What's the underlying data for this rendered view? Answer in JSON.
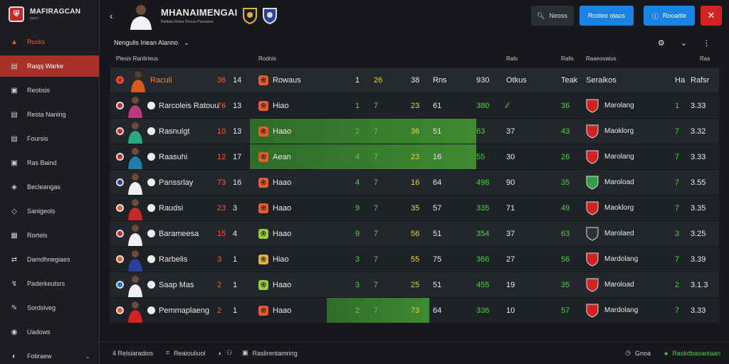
{
  "brand": {
    "title": "MAFIRAGCAN",
    "sub": "aucci"
  },
  "sidebar": {
    "items": [
      {
        "label": "Rocks",
        "icon": "flame-icon",
        "glyph": "▲"
      },
      {
        "label": "Raspj Warke",
        "icon": "table-icon",
        "glyph": "▤",
        "active": true
      },
      {
        "label": "Reotisis",
        "icon": "calendar-icon",
        "glyph": "▣"
      },
      {
        "label": "Resta Naning",
        "icon": "clipboard-icon",
        "glyph": "▤"
      },
      {
        "label": "Foursis",
        "icon": "list-icon",
        "glyph": "▤"
      },
      {
        "label": "Ras Baind",
        "icon": "trophy-icon",
        "glyph": "▣"
      },
      {
        "label": "Becleangas",
        "icon": "users-icon",
        "glyph": "◈"
      },
      {
        "label": "Sanigeols",
        "icon": "pin-icon",
        "glyph": "◇"
      },
      {
        "label": "Rortels",
        "icon": "stats-icon",
        "glyph": "▦"
      },
      {
        "label": "Damdhnegiaes",
        "icon": "transfer-icon",
        "glyph": "⇄"
      },
      {
        "label": "Paderkeutsrs",
        "icon": "share-icon",
        "glyph": "↯"
      },
      {
        "label": "Sordsiveg",
        "icon": "edit-icon",
        "glyph": "✎"
      },
      {
        "label": "Uadows",
        "icon": "settings-icon",
        "glyph": "◉"
      },
      {
        "label": "Fotiraew",
        "icon": "user-icon",
        "glyph": "◐",
        "chevron": "⌄"
      }
    ]
  },
  "topbar": {
    "title": "MHANAIMENGAI",
    "sub": "Ratikaw Rotos Orocos Poonaeus",
    "search_label": "Neoss",
    "blue1_label": "Rcoleo olaos",
    "blue2_label": "Rooaitie",
    "close_label": "✕"
  },
  "filters": {
    "select_label": "Nengulis  Iriean Alanno",
    "chevron": "⌄",
    "tool1": "⚙",
    "tool2": "⌄",
    "tool3": "⋮"
  },
  "table": {
    "headers": {
      "player": "Plesis Ranlirieus",
      "club": "Rodnis",
      "c1": "Rals",
      "c2": "Ralis",
      "c3": "Raaeovatus",
      "c4": "Ras"
    },
    "first_row": {
      "badge": "Raculi",
      "a": "36",
      "b": "14",
      "club": "Rowaus",
      "c1": "1",
      "c2": "26",
      "c3": "38",
      "c4": "Rns",
      "c5": "930",
      "c6": "Otkus",
      "c7": "Teak",
      "c8": "Seraikos",
      "c9": "Ha",
      "c10": "Rafsr"
    },
    "rows": [
      {
        "name": "Rarcoleis Ratouu",
        "a": "76",
        "b": "13",
        "club": "Hiao",
        "g": "1",
        "h": "7",
        "i": "23",
        "j": "61",
        "k": "380",
        "l": "⁄⁄",
        "m": "36",
        "crestColor": "#d32222",
        "stage": "Marolang",
        "s1": "1",
        "s2": "3.33"
      },
      {
        "name": "Rasnulgt",
        "a": "10",
        "b": "13",
        "club": "Haao",
        "g": "2",
        "h": "7",
        "i": "36",
        "j": "51",
        "k": "63",
        "l": "37",
        "m": "43",
        "crestColor": "#d32222",
        "stage": "Maoklorg",
        "s1": "7",
        "s2": "3.32",
        "hl": true
      },
      {
        "name": "Raasuhi",
        "a": "12",
        "b": "17",
        "club": "Aean",
        "g": "4",
        "h": "7",
        "i": "23",
        "j": "16",
        "k": "55",
        "l": "30",
        "m": "26",
        "crestColor": "#d32222",
        "stage": "Marolang",
        "s1": "7",
        "s2": "3.33",
        "hl": true
      },
      {
        "name": "Panssrlay",
        "a": "73",
        "b": "16",
        "club": "Haao",
        "g": "4",
        "h": "7",
        "i": "16",
        "j": "64",
        "k": "498",
        "l": "90",
        "m": "35",
        "crestColor": "#2ea043",
        "stage": "Maroload",
        "s1": "7",
        "s2": "3.55"
      },
      {
        "name": "Raudsi",
        "a": "23",
        "b": "3",
        "club": "Haao",
        "g": "9",
        "h": "7",
        "i": "35",
        "j": "57",
        "k": "335",
        "l": "71",
        "m": "49",
        "crestColor": "#d32222",
        "stage": "Maoklorg",
        "s1": "7",
        "s2": "3.35"
      },
      {
        "name": "Barameesa",
        "a": "15",
        "b": "4",
        "club": "Haao",
        "g": "9",
        "h": "7",
        "i": "56",
        "j": "51",
        "k": "354",
        "l": "37",
        "m": "63",
        "crestColor": "#333333",
        "stage": "Marolaed",
        "s1": "3",
        "s2": "3.25"
      },
      {
        "name": "Rarbelis",
        "a": "3",
        "b": "1",
        "club": "Hiao",
        "g": "3",
        "h": "7",
        "i": "55",
        "j": "75",
        "k": "366",
        "l": "27",
        "m": "56",
        "crestColor": "#d32222",
        "stage": "Mardolang",
        "s1": "7",
        "s2": "3.39"
      },
      {
        "name": "Saap Mas",
        "a": "2",
        "b": "1",
        "club": "Haao",
        "g": "3",
        "h": "7",
        "i": "25",
        "j": "51",
        "k": "455",
        "l": "19",
        "m": "35",
        "crestColor": "#d32222",
        "stage": "Maroload",
        "s1": "2",
        "s2": "3.1.3"
      },
      {
        "name": "Pemmaplaeng",
        "a": "2",
        "b": "1",
        "club": "Haao",
        "g": "2",
        "h": "7",
        "i": "73",
        "j": "64",
        "k": "336",
        "l": "10",
        "m": "57",
        "crestColor": "#d32222",
        "stage": "Mardolang",
        "s1": "7",
        "s2": "3.33",
        "hl2": true
      }
    ]
  },
  "footer": {
    "count": "4 Relsiaradios",
    "f1": "Reaiouliuol",
    "f2": "Raslirentamring",
    "f3": "Gnoa",
    "f4": "Raskdbasantaan"
  },
  "colors": {
    "accent_red": "#a7302b",
    "accent_blue": "#1a82e2",
    "green": "#49d33f",
    "yellow": "#e6d23c"
  }
}
